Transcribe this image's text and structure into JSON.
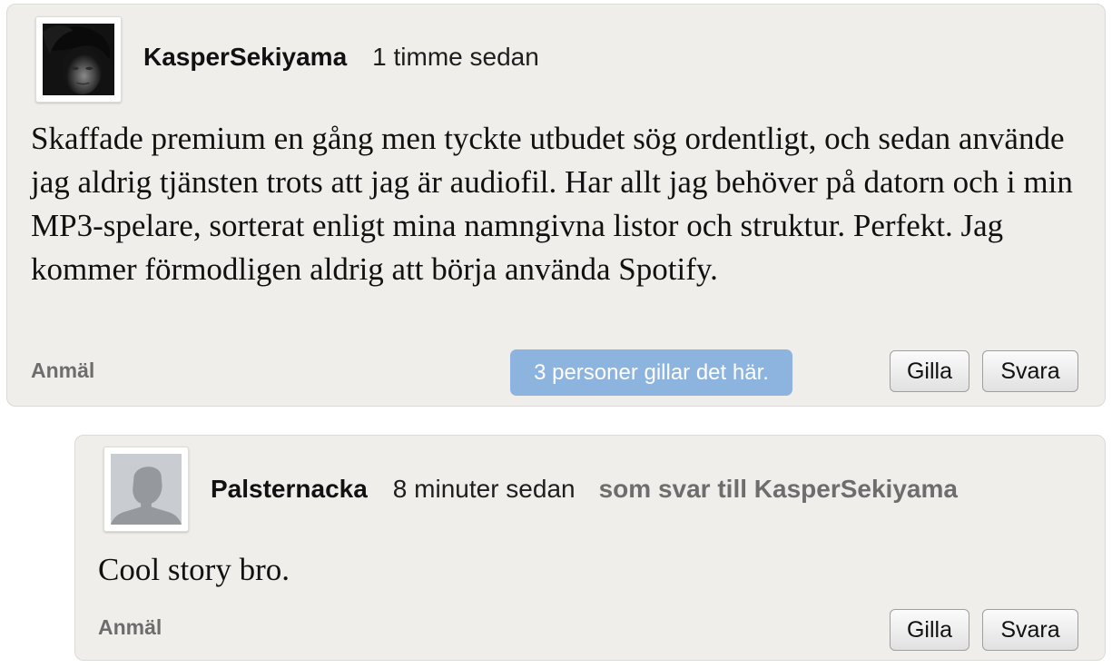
{
  "comments": [
    {
      "avatar_icon": "user-photo-avatar",
      "author": "KasperSekiyama",
      "time": "1 timme sedan",
      "text": "Skaffade premium en gång men tyckte utbudet sög ordentligt, och sedan använde jag aldrig tjänsten trots att jag är audiofil. Har allt jag behöver på datorn och i min MP3-spelare, sorterat enligt mina namngivna listor och struktur. Perfekt. Jag kommer förmodligen aldrig att börja använda Spotify.",
      "report_label": "Anmäl",
      "likes_label": "3 personer gillar det här.",
      "like_label": "Gilla",
      "reply_label": "Svara"
    },
    {
      "avatar_icon": "default-user-silhouette-icon",
      "author": "Palsternacka",
      "time": "8 minuter sedan",
      "reply_to": "som svar till KasperSekiyama",
      "text": "Cool story bro.",
      "report_label": "Anmäl",
      "like_label": "Gilla",
      "reply_label": "Svara"
    }
  ],
  "colors": {
    "card_background": "#efeeea",
    "likes_badge": "#8db4de",
    "muted_text": "#6d6d6d"
  }
}
